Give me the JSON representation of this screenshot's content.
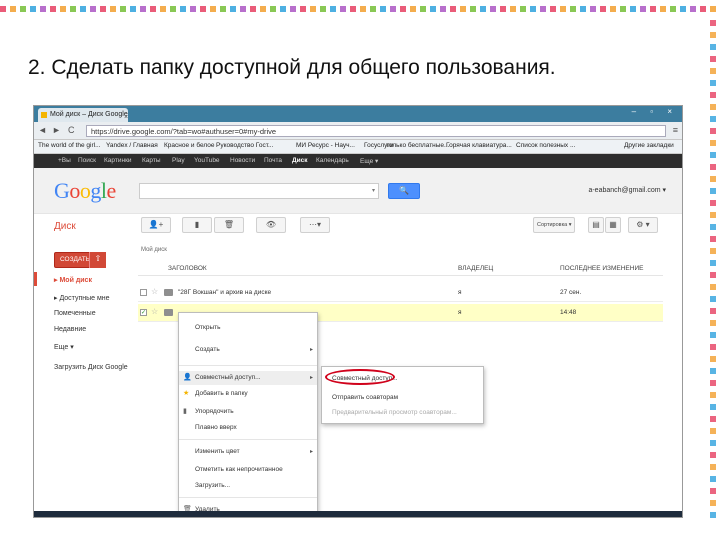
{
  "slide": {
    "title": "2.  Сделать папку доступной для общего пользования."
  },
  "browser": {
    "tab_title": "Мой диск – Диск Google",
    "tab_close": "×",
    "win_btns": "– ▫ ×",
    "nav_back": "◄",
    "nav_forward": "►",
    "nav_reload": "C",
    "url": "https://drive.google.com/?tab=wo#authuser=0#my-drive",
    "menu_icon": "≡"
  },
  "bookmarks": [
    "The world of the girl...",
    "Yandex / Главная",
    "Красное и белое",
    "Руководство Гост...",
    "МИ Ресурс - Науч...",
    "Госуслуги",
    "только бесплатные...",
    "Горячая клавиатура...",
    "Список полезных ...",
    "Другие закладки"
  ],
  "gbar": [
    "+Вы",
    "Поиск",
    "Картинки",
    "Карты",
    "Play",
    "YouTube",
    "Новости",
    "Почта",
    "Диск",
    "Календарь",
    "Еще ▾"
  ],
  "header": {
    "logo": "Google",
    "search_arrow": "▾",
    "search_icon": "🔍",
    "account": "a-eabanch@gmail.com ▾"
  },
  "drive": {
    "title": "Диск",
    "toolbar_icons": [
      "👤+",
      "▮",
      "🗑",
      "👁",
      "⋯▾"
    ],
    "sort_label": "Сортировка ▾",
    "view_icons": [
      "▤",
      "▦",
      "⚙ ▾"
    ],
    "crumb": "Мой диск",
    "create_label": "СОЗДАТЬ",
    "upload_icon": "⇧"
  },
  "sidebar": {
    "items": [
      "▸ Мой диск",
      "▸ Доступные мне",
      "Помеченные",
      "Недавние",
      "Еще ▾",
      "Загрузить Диск Google"
    ]
  },
  "list": {
    "headers": {
      "title": "ЗАГОЛОВОК",
      "owner": "ВЛАДЕЛЕЦ",
      "modified": "ПОСЛЕДНЕЕ ИЗМЕНЕНИЕ"
    },
    "rows": [
      {
        "name": "\"28Г Вокшан\" и архив на диске",
        "owner": "я",
        "modified": "27 сен."
      },
      {
        "name": "...",
        "owner": "я",
        "modified": "14:48"
      }
    ],
    "check": "✓",
    "star": "☆"
  },
  "context_menu": {
    "items": [
      "Открыть",
      "Создать",
      "Совместный доступ...",
      "Добавить в папку",
      "Упорядочить",
      "Плавно вверх",
      "Изменить цвет",
      "Отметить как непрочитанное",
      "Загрузить...",
      "Удалить"
    ],
    "arrow": "▸",
    "icons": [
      "👤",
      "★",
      "▮",
      "🗑"
    ]
  },
  "submenu": {
    "items": [
      "Совместный доступ...",
      "Отправить соавторам",
      "Предварительный просмотр соавторам..."
    ]
  }
}
